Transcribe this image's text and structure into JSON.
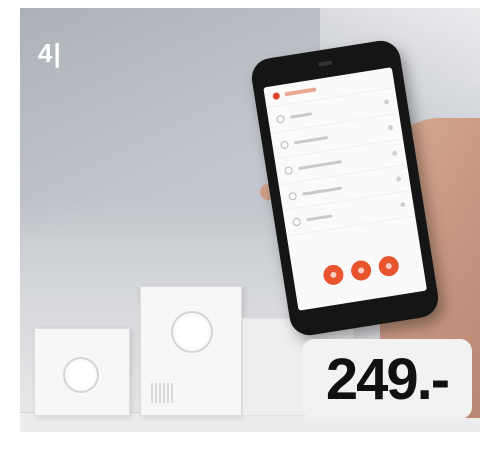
{
  "badge": {
    "text": "4|"
  },
  "price": {
    "text": "249.-"
  },
  "scene": {
    "devices": [
      "small-thermostat",
      "large-thermostat",
      "wall-panel"
    ],
    "phone_app_rows": 5,
    "colors": {
      "accent": "#e8542e",
      "wall": "#c6cacf",
      "price_bg": "#f2f2f2"
    }
  }
}
